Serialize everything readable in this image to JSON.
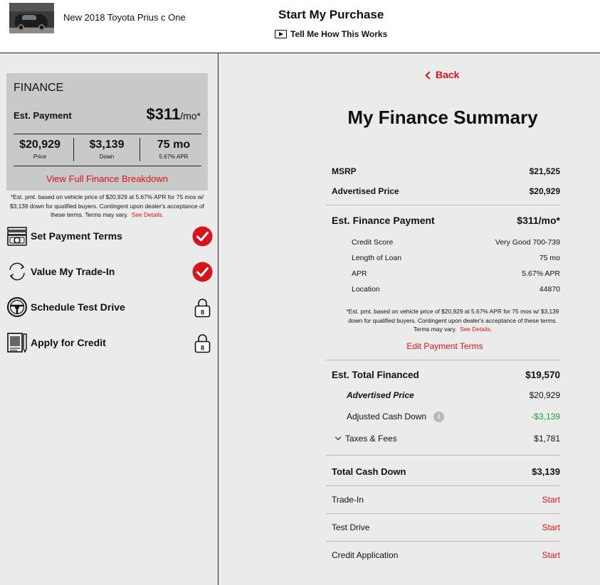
{
  "header": {
    "vehicle_title": "New 2018 Toyota Prius c One",
    "title": "Start My Purchase",
    "how_link": "Tell Me How This Works",
    "thumbnail_alt": "Vehicle photo"
  },
  "finance_card": {
    "title": "FINANCE",
    "est_label": "Est. Payment",
    "est_value": "$311",
    "est_unit": "/mo*",
    "price_value": "$20,929",
    "price_label": "Price",
    "down_value": "$3,139",
    "down_label": "Down",
    "term_value": "75 mo",
    "term_label": "5.67% APR",
    "view_link": "View Full Finance Breakdown"
  },
  "left_disclaimer": {
    "text": "*Est. pmt. based on vehicle price of $20,929 at 5.67% APR for 75 mos w/ $3,139 down for qualified buyers. Contingent upon dealer's acceptance of these terms. Terms may vary.",
    "see_details": "See Details."
  },
  "steps": [
    {
      "label": "Set Payment Terms",
      "icon": "money-icon",
      "status": "complete"
    },
    {
      "label": "Value My Trade-In",
      "icon": "trade-in-icon",
      "status": "complete"
    },
    {
      "label": "Schedule Test Drive",
      "icon": "steering-wheel-icon",
      "status": "locked"
    },
    {
      "label": "Apply for Credit",
      "icon": "credit-application-icon",
      "status": "locked"
    }
  ],
  "summary": {
    "back": "Back",
    "title": "My Finance Summary",
    "msrp_label": "MSRP",
    "msrp_value": "$21,525",
    "adv_label": "Advertised Price",
    "adv_value": "$20,929",
    "efp_label": "Est. Finance Payment",
    "efp_value": "$311/mo*",
    "credit_label": "Credit Score",
    "credit_value": "Very Good 700-739",
    "loan_label": "Length of Loan",
    "loan_value": "75 mo",
    "apr_label": "APR",
    "apr_value": "5.67% APR",
    "location_label": "Location",
    "location_value": "44870",
    "disclaimer": "*Est. pmt. based on vehicle price of $20,929 at 5.67% APR for 75 mos w/ $3,139 down for qualified buyers. Contingent upon dealer's acceptance of these terms. Terms may vary.",
    "see_details": "See Details.",
    "edit_terms": "Edit Payment Terms",
    "total_fin_label": "Est. Total Financed",
    "total_fin_value": "$19,570",
    "adv2_label": "Advertised Price",
    "adv2_value": "$20,929",
    "adj_label": "Adjusted Cash Down",
    "adj_value": "-$3,139",
    "taxes_label": "Taxes & Fees",
    "taxes_value": "$1,781",
    "total_cash_label": "Total Cash Down",
    "total_cash_value": "$3,139",
    "trade_label": "Trade-In",
    "trade_action": "Start",
    "drive_label": "Test Drive",
    "drive_action": "Start",
    "credit_app_label": "Credit Application",
    "credit_app_action": "Start"
  },
  "colors": {
    "accent": "#d7131c",
    "positive": "#1aa03a",
    "panel": "#ebebeb",
    "card": "#c9c9c9"
  }
}
